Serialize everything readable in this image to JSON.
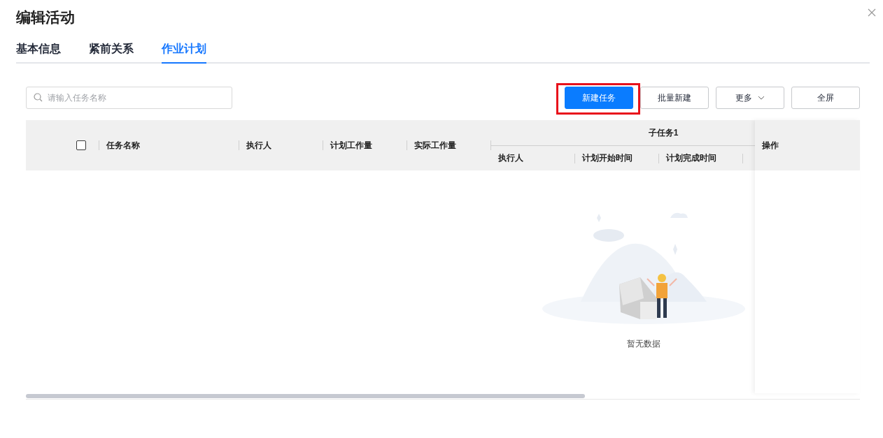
{
  "dialog": {
    "title": "编辑活动"
  },
  "tabs": [
    {
      "label": "基本信息",
      "selected": false
    },
    {
      "label": "紧前关系",
      "selected": false
    },
    {
      "label": "作业计划",
      "selected": true
    }
  ],
  "search": {
    "placeholder": "请输入任务名称"
  },
  "toolbar": [
    {
      "label": "新建任务",
      "kind": "primary",
      "highlighted": true
    },
    {
      "label": "批量新建",
      "kind": "default",
      "highlighted": false
    },
    {
      "label": "更多",
      "kind": "dropdown",
      "highlighted": false
    },
    {
      "label": "全屏",
      "kind": "default",
      "highlighted": false
    }
  ],
  "table": {
    "select_all": {
      "checked": false
    },
    "columns": [
      "任务名称",
      "执行人",
      "计划工作量",
      "实际工作量"
    ],
    "group": {
      "title": "子任务1",
      "columns": [
        "执行人",
        "计划开始时间",
        "计划完成时间"
      ]
    },
    "action_column": "操作",
    "empty_text": "暂无数据"
  }
}
